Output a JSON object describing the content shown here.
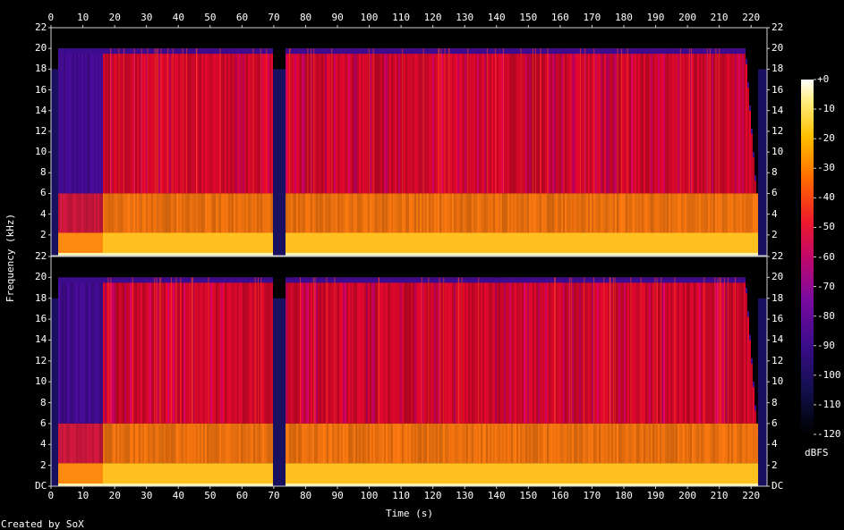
{
  "chart_data": {
    "type": "heatmap",
    "xlabel": "Time (s)",
    "ylabel": "Frequency (kHz)",
    "credit": "Created by SoX",
    "colorbar_unit": "dBFS",
    "x_ticks": [
      0,
      10,
      20,
      30,
      40,
      50,
      60,
      70,
      80,
      90,
      100,
      110,
      120,
      130,
      140,
      150,
      160,
      170,
      180,
      190,
      200,
      210,
      220
    ],
    "xlim": [
      0,
      225
    ],
    "y_ticks_top": [
      "22",
      "20",
      "18",
      "16",
      "14",
      "12",
      "10",
      "8",
      "6",
      "4",
      "2"
    ],
    "y_ticks_bottom": [
      "22",
      "20",
      "18",
      "16",
      "14",
      "12",
      "10",
      "8",
      "6",
      "4",
      "2",
      "DC"
    ],
    "ylim_khz": [
      0,
      22
    ],
    "colorbar_ticks": [
      "+0",
      "-10",
      "-20",
      "-30",
      "-40",
      "-50",
      "-60",
      "-70",
      "-80",
      "-90",
      "-100",
      "-110",
      "-120"
    ],
    "colorbar_range_dbfs": [
      -120,
      0
    ],
    "channels": [
      {
        "quiet_segments_s": [
          [
            0,
            2
          ],
          [
            69.5,
            73.5
          ],
          [
            222,
            225
          ]
        ],
        "rolloff_khz": 20,
        "tail_fade_start_s": 218
      },
      {
        "quiet_segments_s": [
          [
            0,
            2
          ],
          [
            69.5,
            73.5
          ],
          [
            222,
            225
          ]
        ],
        "rolloff_khz": 20,
        "tail_fade_start_s": 218
      }
    ]
  }
}
